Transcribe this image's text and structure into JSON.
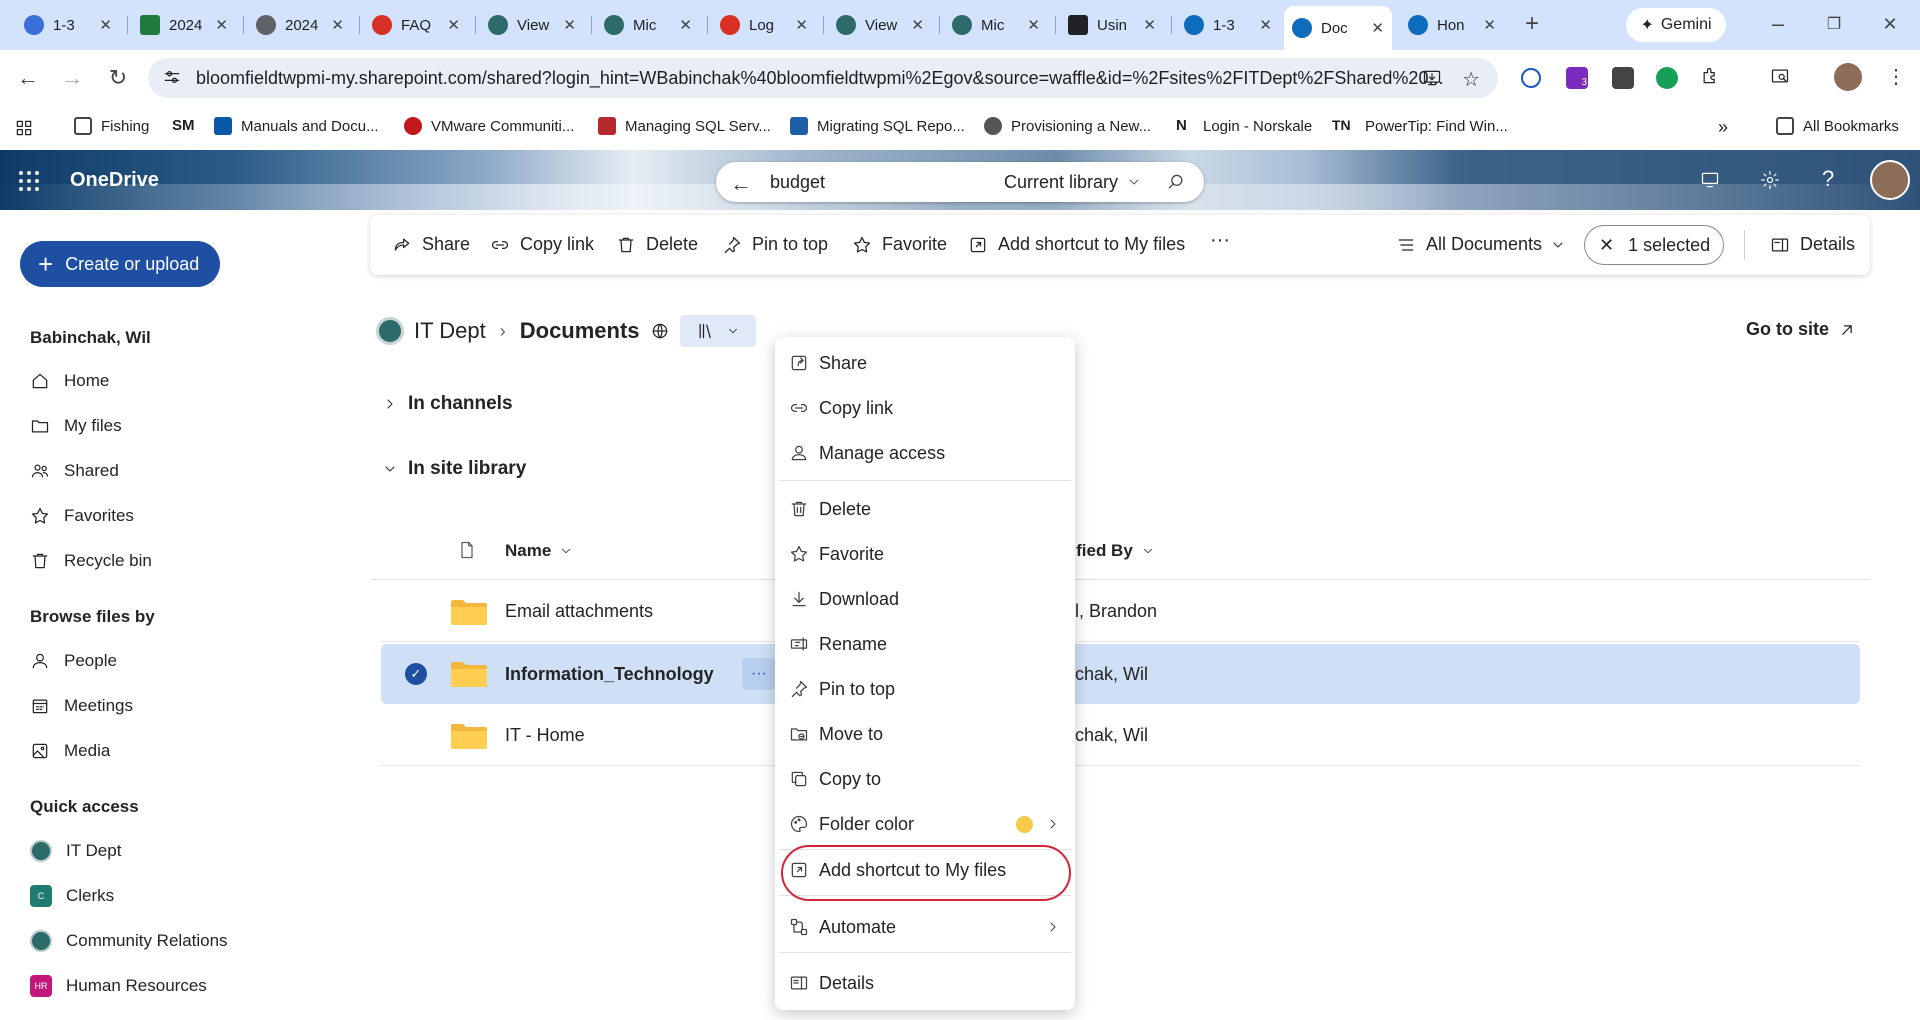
{
  "browser": {
    "tabs": [
      {
        "title": "1-3",
        "icon": "app-icon",
        "color": "#3a6ed8"
      },
      {
        "title": "2024",
        "icon": "sheet-icon",
        "color": "#1e7b3c"
      },
      {
        "title": "2024",
        "icon": "globe-icon",
        "color": "#5f6368"
      },
      {
        "title": "FAQ",
        "icon": "app-icon",
        "color": "#d93025"
      },
      {
        "title": "View",
        "icon": "seal-icon",
        "color": "#2d6a6a"
      },
      {
        "title": "Mic",
        "icon": "seal-icon",
        "color": "#2d6a6a"
      },
      {
        "title": "Log",
        "icon": "app-icon",
        "color": "#d93025"
      },
      {
        "title": "View",
        "icon": "seal-icon",
        "color": "#2d6a6a"
      },
      {
        "title": "Mic",
        "icon": "seal-icon",
        "color": "#2d6a6a"
      },
      {
        "title": "Usin",
        "icon": "doc-icon",
        "color": "#202124"
      },
      {
        "title": "1-3",
        "icon": "cloud-icon",
        "color": "#0f6cbd"
      },
      {
        "title": "Doc",
        "icon": "cloud-icon",
        "color": "#0f6cbd"
      },
      {
        "title": "Hon",
        "icon": "cloud-icon",
        "color": "#0f6cbd"
      }
    ],
    "gemini_label": "Gemini",
    "url": "bloomfieldtwpmi-my.sharepoint.com/shared?login_hint=WBabinchak%40bloomfieldtwpmi%2Egov&source=waffle&id=%2Fsites%2FITDept%2FShared%20...",
    "bookmarks": [
      {
        "label": "Fishing"
      },
      {
        "label": "SM"
      },
      {
        "label": "Manuals and Docu..."
      },
      {
        "label": "VMware Communiti..."
      },
      {
        "label": "Managing SQL Serv..."
      },
      {
        "label": "Migrating SQL Repo..."
      },
      {
        "label": "Provisioning a New..."
      },
      {
        "label": "Login - Norskale"
      },
      {
        "label": "PowerTip: Find Win..."
      }
    ],
    "all_bookmarks": "All Bookmarks",
    "extension_badge": "3"
  },
  "suite": {
    "app_name": "OneDrive",
    "search_value": "budget",
    "search_scope": "Current library"
  },
  "nav": {
    "create_label": "Create or upload",
    "user_name": "Babinchak, Wil",
    "items": [
      {
        "label": "Home"
      },
      {
        "label": "My files"
      },
      {
        "label": "Shared"
      },
      {
        "label": "Favorites"
      },
      {
        "label": "Recycle bin"
      }
    ],
    "browse_heading": "Browse files by",
    "browse": [
      {
        "label": "People"
      },
      {
        "label": "Meetings"
      },
      {
        "label": "Media"
      }
    ],
    "quick_heading": "Quick access",
    "quick": [
      {
        "label": "IT Dept",
        "badge": "",
        "color": "#2d6a6a"
      },
      {
        "label": "Clerks",
        "badge": "C",
        "color": "#1e7b6f"
      },
      {
        "label": "Community Relations",
        "badge": "",
        "color": "#2d6a6a"
      },
      {
        "label": "Human Resources",
        "badge": "HR",
        "color": "#c2187d"
      }
    ]
  },
  "commands": {
    "share": "Share",
    "copy_link": "Copy link",
    "delete": "Delete",
    "pin": "Pin to top",
    "favorite": "Favorite",
    "shortcut": "Add shortcut to My files",
    "more": "···",
    "view": "All Documents",
    "selected": "1 selected",
    "details": "Details"
  },
  "breadcrumb": {
    "site": "IT Dept",
    "library": "Documents",
    "goto_site": "Go to site"
  },
  "sections": {
    "channels": "In channels",
    "site_library": "In site library"
  },
  "list": {
    "col_name": "Name",
    "col_modified_by": "dified By",
    "rows": [
      {
        "name": "Email attachments",
        "modified_by": "ell, Brandon",
        "selected": false
      },
      {
        "name": "Information_Technology",
        "modified_by": "inchak, Wil",
        "selected": true
      },
      {
        "name": "IT - Home",
        "modified_by": "inchak, Wil",
        "selected": false
      }
    ]
  },
  "context_menu": {
    "items": [
      {
        "label": "Share",
        "icon": "share-icon"
      },
      {
        "label": "Copy link",
        "icon": "link-icon"
      },
      {
        "label": "Manage access",
        "icon": "person-icon"
      },
      {
        "label": "Delete",
        "icon": "trash-icon"
      },
      {
        "label": "Favorite",
        "icon": "star-icon"
      },
      {
        "label": "Download",
        "icon": "download-icon"
      },
      {
        "label": "Rename",
        "icon": "rename-icon"
      },
      {
        "label": "Pin to top",
        "icon": "pin-icon"
      },
      {
        "label": "Move to",
        "icon": "move-icon"
      },
      {
        "label": "Copy to",
        "icon": "copy-icon"
      },
      {
        "label": "Folder color",
        "icon": "palette-icon"
      },
      {
        "label": "Add shortcut to My files",
        "icon": "shortcut-icon"
      },
      {
        "label": "Automate",
        "icon": "flow-icon"
      },
      {
        "label": "Details",
        "icon": "details-icon"
      }
    ],
    "folder_color_swatch": "#f7c948",
    "highlight_color": "#d1243a"
  },
  "colors": {
    "accent": "#1e4fa3",
    "selected_row": "#cfe0f6",
    "tab_strip": "#d3e3fd"
  }
}
